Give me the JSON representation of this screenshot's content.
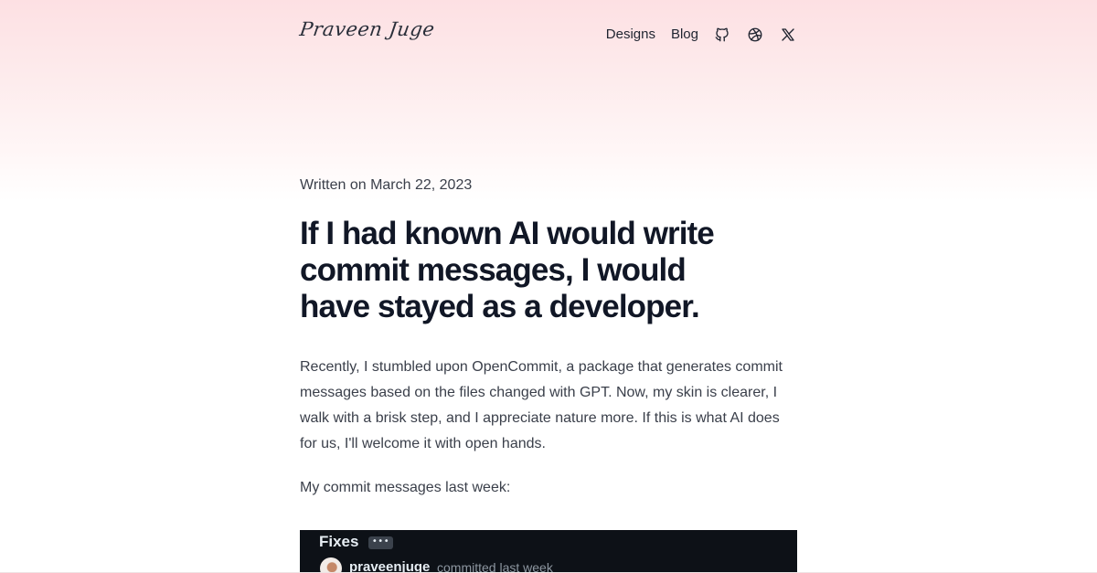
{
  "site": {
    "logo": "Praveen Juge"
  },
  "nav": {
    "items": [
      {
        "label": "Designs"
      },
      {
        "label": "Blog"
      }
    ],
    "icons": [
      "github-icon",
      "dribbble-icon",
      "x-icon"
    ]
  },
  "article": {
    "date": "Written on March 22, 2023",
    "title": "If I had known AI would write commit messages, I would have stayed as a developer.",
    "paragraphs": [
      "Recently, I stumbled upon OpenCommit, a package that generates commit messages based on the files changed with GPT. Now, my skin is clearer, I walk with a brisk step, and I appreciate nature more. If this is what AI does for us, I'll welcome it with open hands.",
      "My commit messages last week:"
    ]
  },
  "screenshot": {
    "heading": "Fixes",
    "ellipsis": "•••",
    "author": "praveenjuge",
    "meta": "committed last week"
  },
  "colors": {
    "header_gradient_top": "#fde0e3",
    "title": "#111726",
    "body_text": "#3a3f4a",
    "screenshot_bg": "#0d1117"
  }
}
